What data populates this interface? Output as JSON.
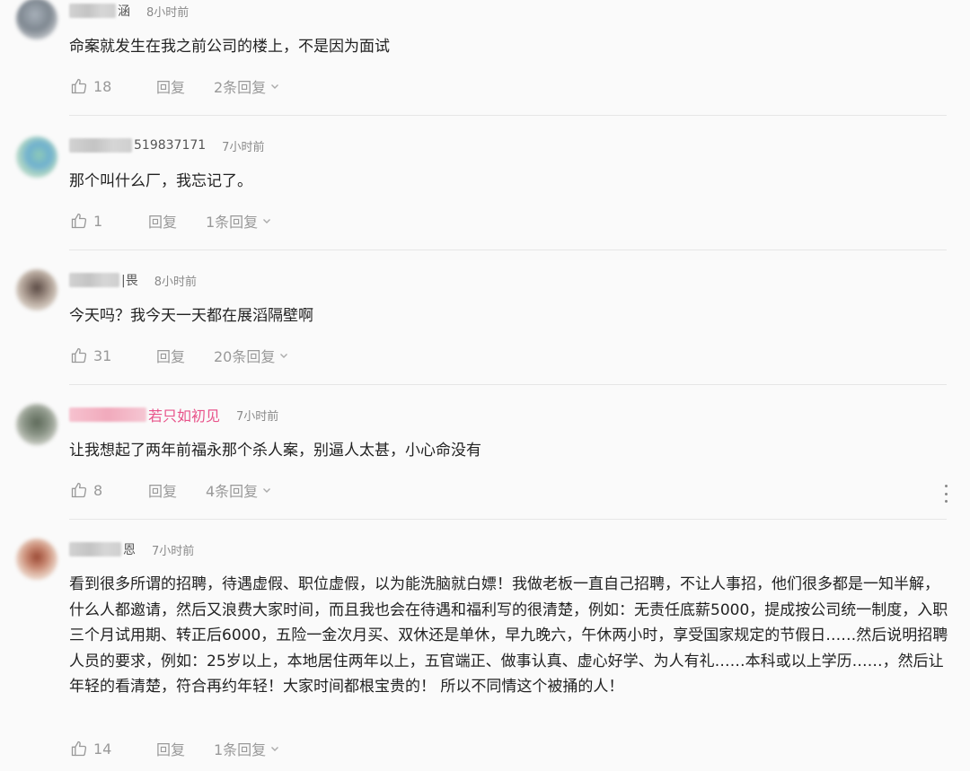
{
  "icons": {
    "like": "thumbs-up-icon",
    "chevron": "chevron-down-icon",
    "more": "more-vertical-icon"
  },
  "comments": [
    {
      "name_tail": "涵",
      "time": "8小时前",
      "text": "命案就发生在我之前公司的楼上，不是因为面试",
      "likes": "18",
      "reply_label": "回复",
      "replies": "2条回复"
    },
    {
      "name_tail": "519837171",
      "time": "7小时前",
      "text": "那个叫什么厂，我忘记了。",
      "likes": "1",
      "reply_label": "回复",
      "replies": "1条回复"
    },
    {
      "name_tail": "|畏",
      "time": "8小时前",
      "text": "今天吗？我今天一天都在展滔隔壁啊",
      "likes": "31",
      "reply_label": "回复",
      "replies": "20条回复"
    },
    {
      "name_tail": "若只如初见",
      "time": "7小时前",
      "text": "让我想起了两年前福永那个杀人案，别逼人太甚，小心命没有",
      "likes": "8",
      "reply_label": "回复",
      "replies": "4条回复"
    },
    {
      "name_tail": "恩",
      "time": "7小时前",
      "text": "看到很多所谓的招聘，待遇虚假、职位虚假，以为能洗脑就白嫖！我做老板一直自己招聘，不让人事招，他们很多都是一知半解，什么人都邀请，然后又浪费大家时间，而且我也会在待遇和福利写的很清楚，例如：无责任底薪5000，提成按公司统一制度，入职三个月试用期、转正后6000，五险一金次月买、双休还是单休，早九晚六，午休两小时，享受国家规定的节假日……然后说明招聘人员的要求，例如：25岁以上，本地居住两年以上，五官端正、做事认真、虚心好学、为人有礼……本科或以上学历……，然后让年轻的看清楚，符合再约年轻！大家时间都根宝贵的！ 所以不同情这个被捅的人！",
      "likes": "14",
      "reply_label": "回复",
      "replies": "1条回复"
    }
  ]
}
